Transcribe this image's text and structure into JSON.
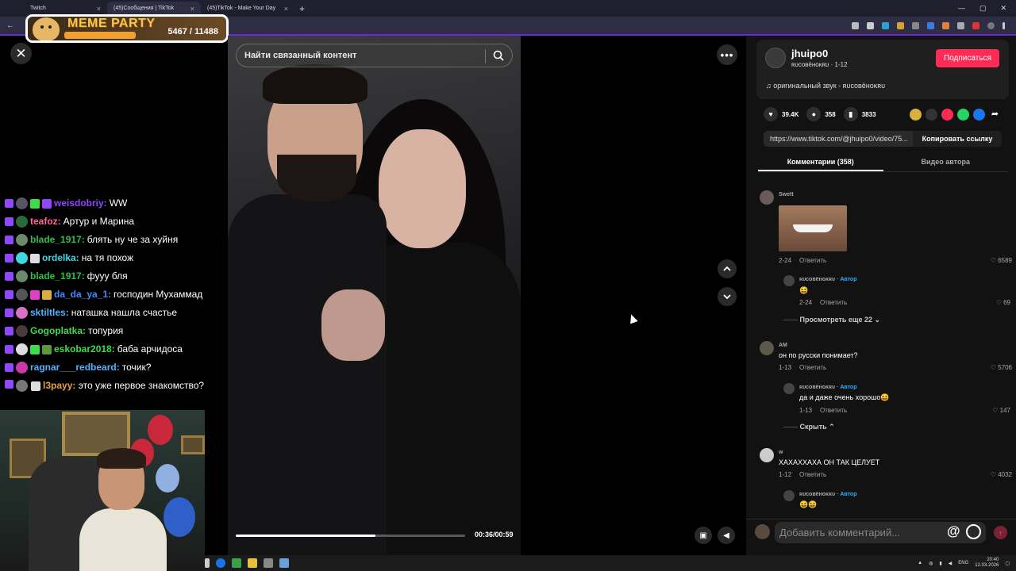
{
  "browser": {
    "tabs": [
      {
        "label": "Twitch",
        "active": false
      },
      {
        "label": "(45)Сообщения | TikTok",
        "active": true
      },
      {
        "label": "(45)TikTok - Make Your Day",
        "active": false
      }
    ],
    "new_tab_label": "+"
  },
  "overlay": {
    "title": "MEME PARTY",
    "score": "5467 / 11488"
  },
  "chat": {
    "messages": [
      {
        "nick": "weisdobriy:",
        "color": "#9146ff",
        "text": "WW"
      },
      {
        "nick": "teafoz:",
        "color": "#ff6a9a",
        "text": "Артур и Марина"
      },
      {
        "nick": "blade_1917:",
        "color": "#2fbf4a",
        "text": "блять ну че за хуйня"
      },
      {
        "nick": "ordelka:",
        "color": "#3dd9e0",
        "text": "на тя похож"
      },
      {
        "nick": "blade_1917:",
        "color": "#2fbf4a",
        "text": "фууу бля"
      },
      {
        "nick": "da_da_ya_1:",
        "color": "#3d8bff",
        "text": "господин Мухаммад"
      },
      {
        "nick": "sktiltles:",
        "color": "#4fb3ff",
        "text": "наташка нашла счастье"
      },
      {
        "nick": "Gogoplatka:",
        "color": "#3ddc4a",
        "text": "топурия"
      },
      {
        "nick": "eskobar2018:",
        "color": "#3ddc4a",
        "text": "баба арчидоса"
      },
      {
        "nick": "ragnar___redbeard:",
        "color": "#4fb3ff",
        "text": "точик?"
      },
      {
        "nick": "l3payy:",
        "color": "#e8a23a",
        "text": "это уже первое знакомство?"
      }
    ]
  },
  "video": {
    "search_placeholder": "Найти связанный контент",
    "timecode": "00:36/00:59",
    "progress": 0.61
  },
  "author": {
    "name": "jhuipo0",
    "sub": "ʀᴜсᴏʙёнᴏᴋʀᴜ · 1-12",
    "follow_label": "Подписаться",
    "sound": "оригинальный звук - ʀᴜсᴏʙёнᴏᴋʀᴜ"
  },
  "stats": {
    "likes": "39.4K",
    "comments": "358",
    "saves": "3833"
  },
  "link": {
    "url": "https://www.tiktok.com/@jhuipo0/video/75...",
    "copy_label": "Копировать ссылку"
  },
  "tabs": {
    "comments": "Комментарии (358)",
    "author_videos": "Видео автора"
  },
  "comments": {
    "c1": {
      "name": "Swett",
      "date": "2-24",
      "reply": "Ответить",
      "likes": "6589"
    },
    "r1": {
      "name": "ʀᴜсᴏʙёнᴏᴋʀᴜ",
      "tag": "· Автор",
      "text": "😆",
      "date": "2-24",
      "reply": "Ответить",
      "likes": "69"
    },
    "more1": "Просмотреть еще 22",
    "c2": {
      "name": "AM",
      "text": "он по русски понимает?",
      "date": "1-13",
      "reply": "Ответить",
      "likes": "5706"
    },
    "r2": {
      "name": "ʀᴜсᴏʙёнᴏᴋʀᴜ",
      "tag": "· Автор",
      "text": "да и даже очень хорошо😆",
      "date": "1-13",
      "reply": "Ответить",
      "likes": "147"
    },
    "hide2": "Скрыть",
    "c3": {
      "name": "w",
      "text": "ХАХАХХАХА ОН ТАК ЦЕЛУЕТ",
      "date": "1-12",
      "reply": "Ответить",
      "likes": "4032"
    },
    "r3": {
      "name": "ʀᴜсᴏʙёнᴏᴋʀᴜ",
      "tag": "· Автор",
      "text": "😆😆"
    }
  },
  "compose": {
    "placeholder": "Добавить комментарий...",
    "at": "@"
  },
  "taskbar": {
    "lang": "ENG",
    "time": "20:40",
    "date": "12.03.2026"
  }
}
